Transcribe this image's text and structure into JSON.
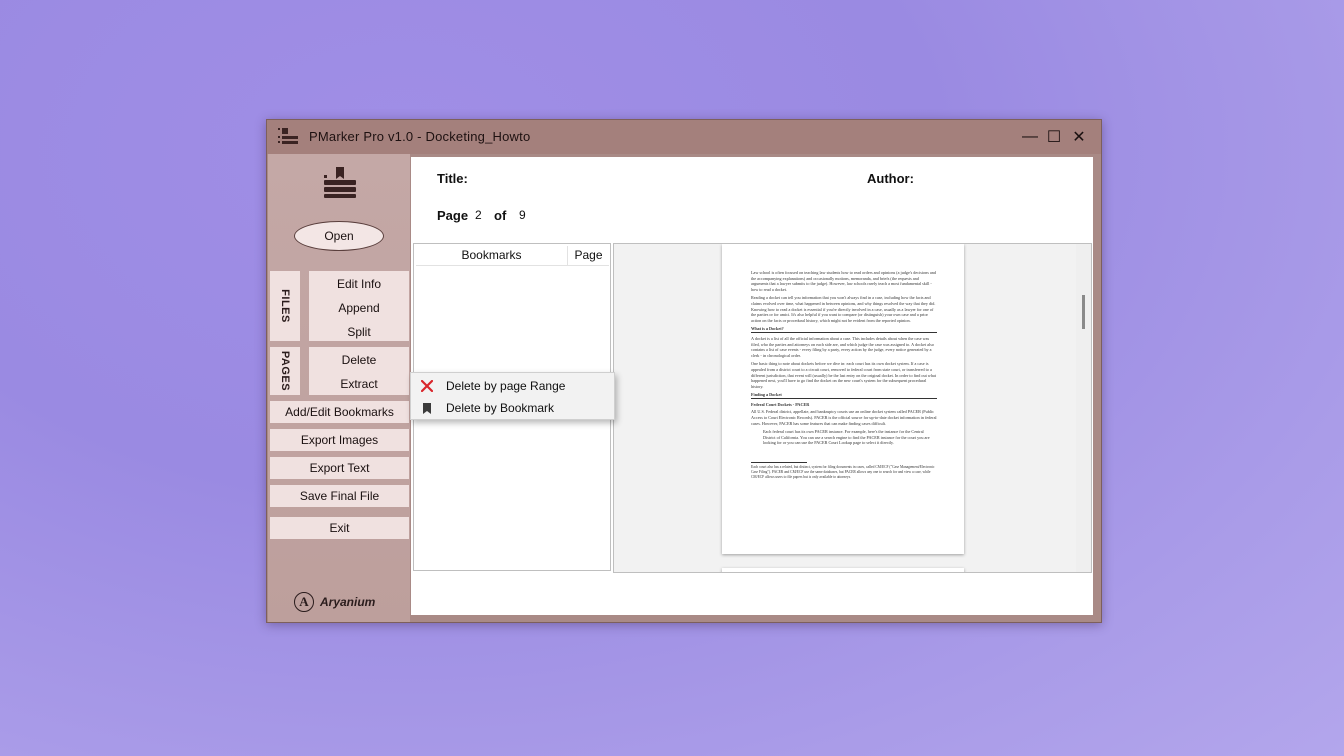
{
  "window": {
    "title": "PMarker Pro v1.0 - Docketing_Howto"
  },
  "titlebar_buttons": {
    "minimize": "—",
    "maximize": "☐",
    "close": "✕"
  },
  "sidebar": {
    "open_label": "Open",
    "files_tab": "FILES",
    "pages_tab": "PAGES",
    "files_items": [
      "Edit Info",
      "Append",
      "Split"
    ],
    "pages_items": [
      "Delete",
      "Extract"
    ],
    "add_bookmarks": "Add/Edit Bookmarks",
    "export_images": "Export Images",
    "export_text": "Export Text",
    "save_final": "Save Final File",
    "exit": "Exit",
    "brand_letter": "A",
    "brand": "Aryanium"
  },
  "doc": {
    "title_label": "Title:",
    "author_label": "Author:",
    "page_label": "Page",
    "page_current": "2",
    "of_label": "of",
    "page_total": "9"
  },
  "bookmarks": {
    "col_bookmarks": "Bookmarks",
    "col_page": "Page"
  },
  "context_menu": {
    "items": [
      {
        "label": "Delete by page Range",
        "icon": "red-x-icon"
      },
      {
        "label": "Delete by Bookmark",
        "icon": "bookmark-icon"
      }
    ]
  },
  "pdf": {
    "para1": "Law school is often focused on teaching law students how to read orders and opinions (a judge's decisions and the accompanying explanations) and occasionally motions, memoranda, and briefs (the requests and arguments that a lawyer submits to the judge). However, law schools rarely teach a most fundamental skill - how to read a docket.",
    "para2": "Reading a docket can tell you information that you won't always find in a case, including how the facts and claims evolved over time, what happened in between opinions, and why things resolved the way that they did. Knowing how to read a docket is essential if you're directly involved in a case, usually as a lawyer for one of the parties or for amici. It's also helpful if you want to compare (or distinguish) your own case and a prior action on the facts or procedural history, which might not be evident from the reported opinion.",
    "h1": "What is a Docket?",
    "para3": "A docket is a list of all the official information about a case. This includes details about when the case was filed, who the parties and attorneys on each side are, and which judge the case was assigned to. A docket also contains a list of case events - every filing by a party, every action by the judge, every notice generated by a clerk - in chronological order.",
    "para4": "One basic thing to note about dockets before we dive in: each court has its own docket system. If a case is appealed from a district court to a circuit court, removed to federal court from state court, or transferred to a different jurisdiction, that event will (usually) be the last entry on the original docket. In order to find out what happened next, you'll have to go find the docket on the new court's system for the subsequent procedural history.",
    "h2": "Finding a Docket",
    "h3": "Federal Court Dockets - PACER",
    "para5": "All U.S. Federal district, appellate, and bankruptcy courts use an online docket system called PACER (Public Access to Court Electronic Records). PACER is the official source for up-to-date docket information in federal cases. However, PACER has some features that can make finding cases difficult.",
    "bullet": "Each federal court has its own PACER instance. For example, here's the instance for the Central District of California. You can use a search engine to find the PACER instance for the court you are looking for or you can use the PACER Court Lookup page to select it directly.",
    "footnote": "Each court also has a related, but distinct, system for filing documents in cases, called CM/ECF (\"Case Management/Electronic Case Filing\"). PACER and CM/ECF use the same databases, but PACER allows any one to search for and view a case, while CM/ECF allows users to file papers but is only available to attorneys."
  }
}
